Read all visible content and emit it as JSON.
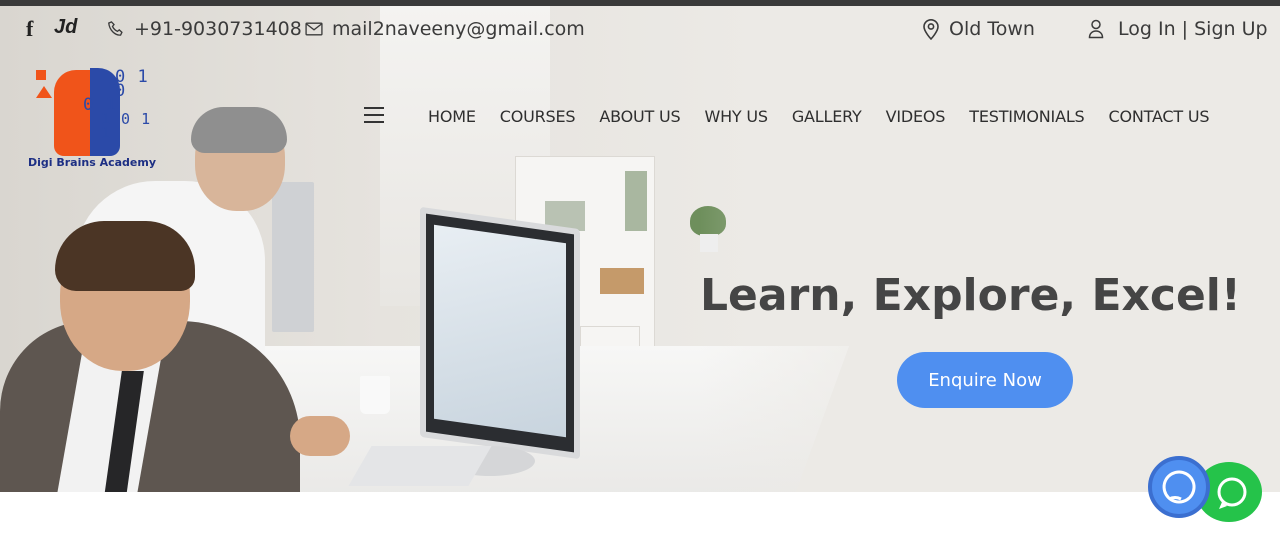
{
  "topbar": {
    "social": [
      {
        "icon": "facebook-icon",
        "label": "f"
      },
      {
        "icon": "justdial-icon",
        "label": "Jd"
      }
    ],
    "phone": "+91-9030731408",
    "email": "mail2naveeny@gmail.com",
    "location": "Old Town",
    "auth": "Log In | Sign Up"
  },
  "logo": {
    "bits_line1": "0 1 0",
    "bits_line2": "0 1",
    "bits_line3": "1 0 1 1",
    "name": "Digi Brains Academy"
  },
  "nav": {
    "items": [
      "HOME",
      "COURSES",
      "ABOUT US",
      "WHY US",
      "GALLERY",
      "VIDEOS",
      "TESTIMONIALS",
      "CONTACT US"
    ]
  },
  "hero": {
    "headline": "Learn, Explore, Excel!",
    "cta": "Enquire Now"
  },
  "floating": {
    "whatsapp": "whatsapp-icon",
    "chat": "chat-icon"
  },
  "colors": {
    "accent": "#4f8ff0",
    "brand_orange": "#f0541a",
    "brand_blue": "#2b4aa8",
    "whatsapp": "#25c34a"
  }
}
